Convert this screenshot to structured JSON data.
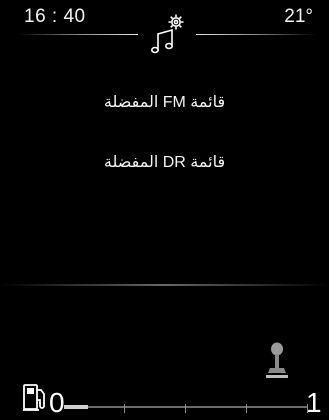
{
  "status_bar": {
    "time": "16 : 40",
    "temperature": "21°"
  },
  "header": {
    "icon": "music-settings-icon"
  },
  "menu": {
    "items": [
      {
        "label": "قائمة FM المفضلة"
      },
      {
        "label": "قائمة DR المفضلة"
      }
    ]
  },
  "eco_indicator": {
    "icon": "gear-shift-icon"
  },
  "fuel_gauge": {
    "icon": "fuel-pump-icon",
    "empty_label": "0",
    "full_label": "1",
    "level_fraction": 0.1
  }
}
